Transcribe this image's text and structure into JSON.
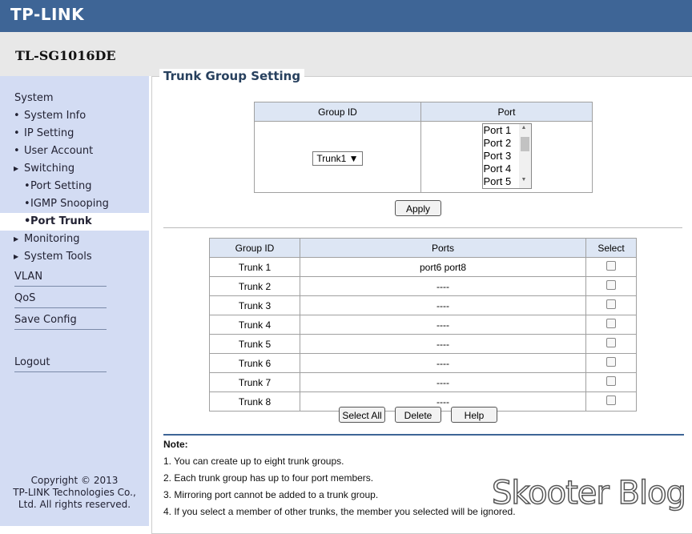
{
  "brand": "TP-LINK",
  "model": "TL-SG1016DE",
  "sidebar": {
    "system": "System",
    "items": [
      {
        "label": "System Info"
      },
      {
        "label": "IP Setting"
      },
      {
        "label": "User Account"
      }
    ],
    "switching": "Switching",
    "sub_items": [
      {
        "label": "Port Setting"
      },
      {
        "label": "IGMP Snooping"
      },
      {
        "label": "Port Trunk"
      }
    ],
    "monitoring": "Monitoring",
    "system_tools": "System Tools",
    "vlan": "VLAN",
    "qos": "QoS",
    "save_config": "Save Config",
    "logout": "Logout",
    "copyright_1": "Copyright © 2013",
    "copyright_2": "TP-LINK Technologies Co.,",
    "copyright_3": "Ltd. All rights reserved."
  },
  "panel_title": "Trunk Group Setting",
  "setting": {
    "col_group": "Group ID",
    "col_port": "Port",
    "group_selected": "Trunk1",
    "ports": [
      "Port 1",
      "Port 2",
      "Port 3",
      "Port 4",
      "Port 5"
    ],
    "apply": "Apply"
  },
  "table": {
    "col_group": "Group ID",
    "col_ports": "Ports",
    "col_select": "Select",
    "rows": [
      {
        "group": "Trunk 1",
        "ports": "port6 port8"
      },
      {
        "group": "Trunk 2",
        "ports": "----"
      },
      {
        "group": "Trunk 3",
        "ports": "----"
      },
      {
        "group": "Trunk 4",
        "ports": "----"
      },
      {
        "group": "Trunk 5",
        "ports": "----"
      },
      {
        "group": "Trunk 6",
        "ports": "----"
      },
      {
        "group": "Trunk 7",
        "ports": "----"
      },
      {
        "group": "Trunk 8",
        "ports": "----"
      }
    ]
  },
  "buttons": {
    "select_all": "Select All",
    "delete": "Delete",
    "help": "Help"
  },
  "note": {
    "title": "Note:",
    "lines": [
      "1. You can create up to eight trunk groups.",
      "2. Each trunk group has up to four port members.",
      "3. Mirroring port cannot be added to a trunk group.",
      "4. If you select a member of other trunks, the member you selected will be ignored."
    ]
  },
  "watermark": "Skooter Blog",
  "colors": {
    "header": "#3e6596",
    "sidebar": "#d3dcf3",
    "table_header": "#dde6f4"
  }
}
